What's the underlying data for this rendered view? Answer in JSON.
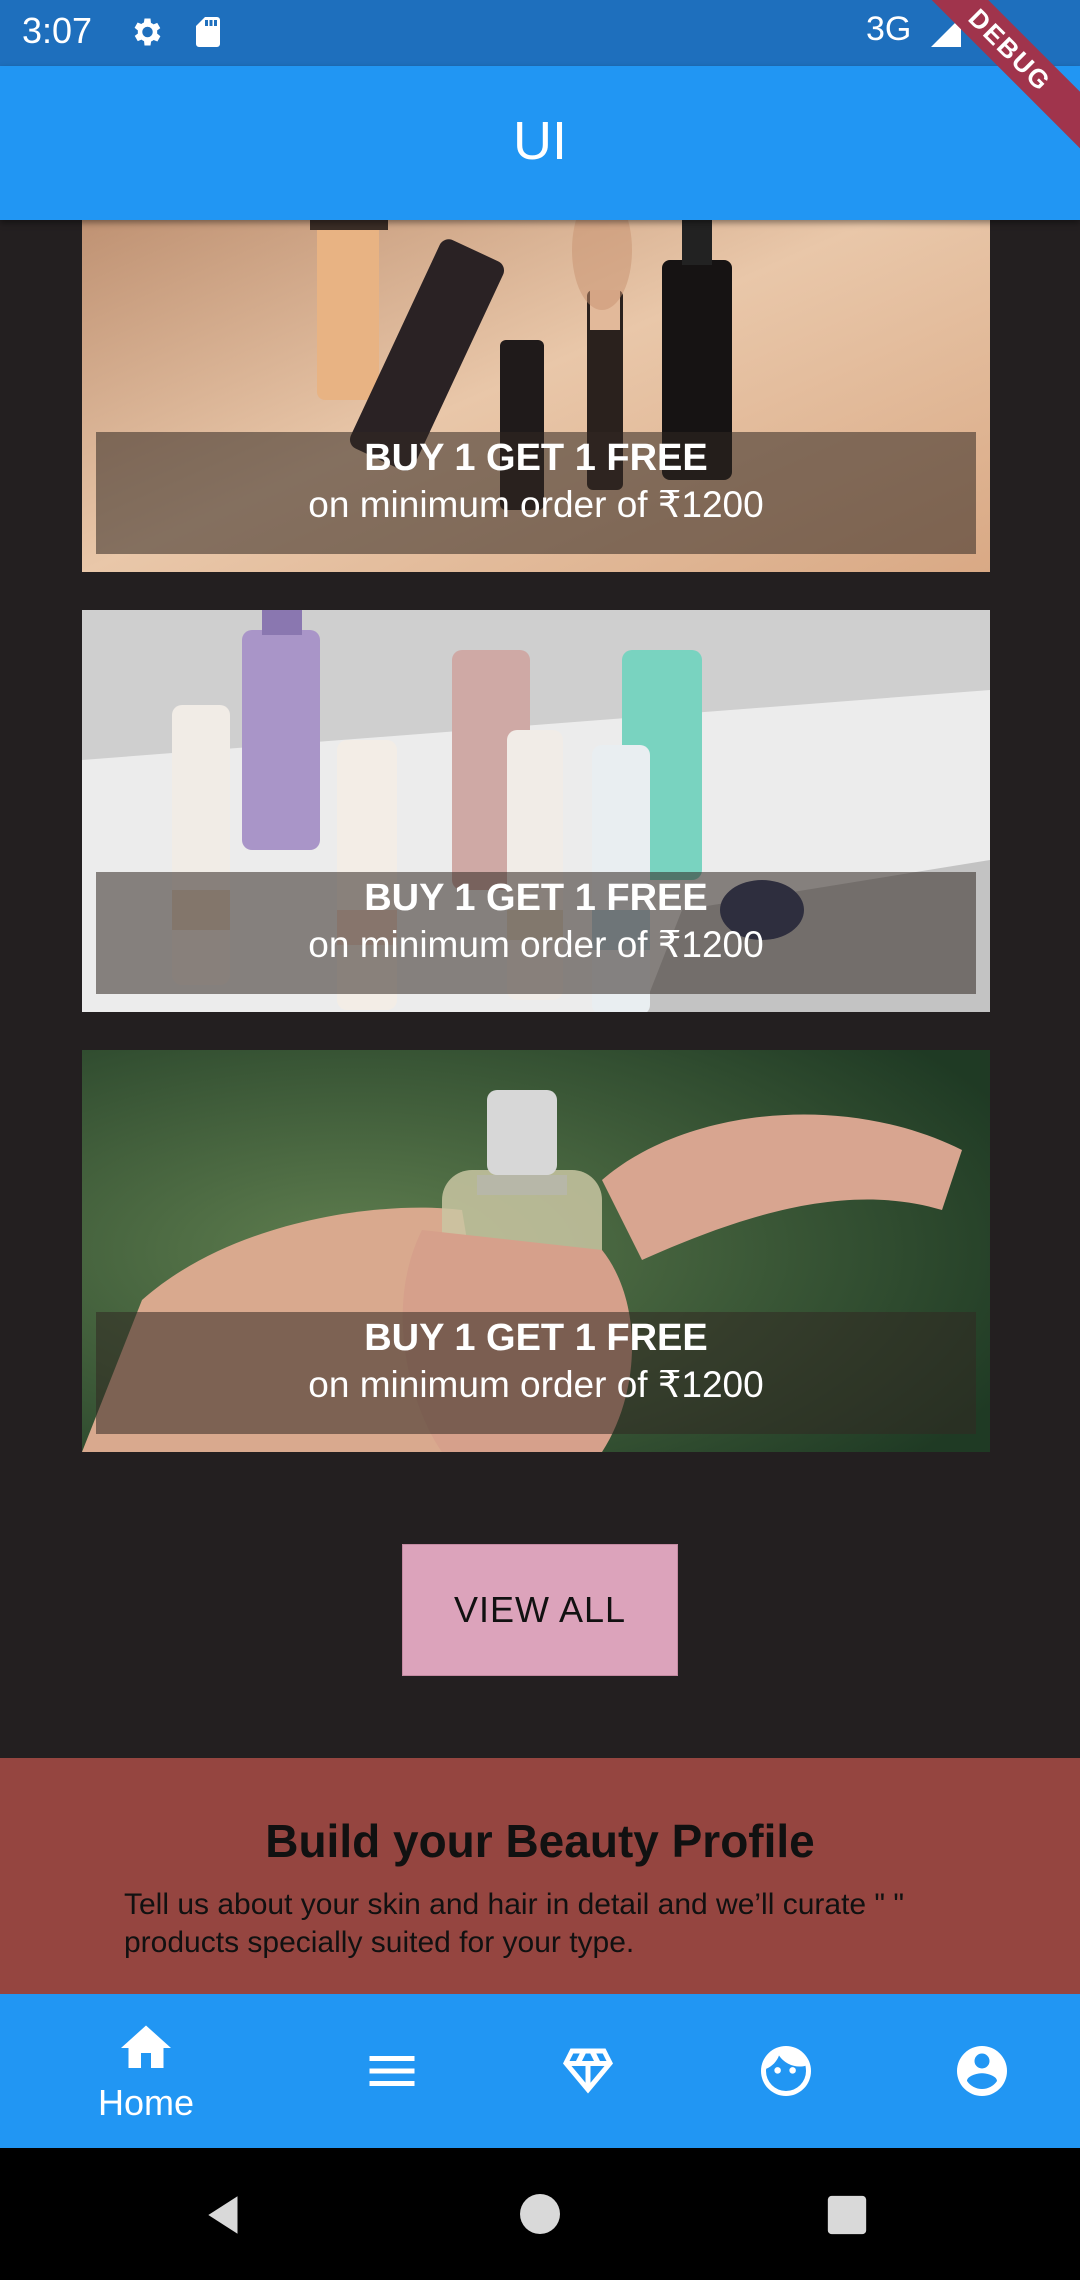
{
  "status": {
    "time": "3:07",
    "network": "3G",
    "debug_label": "DEBUG"
  },
  "app_bar": {
    "title": "UI"
  },
  "offers": [
    {
      "title": "BUY 1 GET 1 FREE",
      "subtitle": "on minimum order of ₹1200",
      "image": "makeup-foundation-bottles"
    },
    {
      "title": "BUY 1 GET 1 FREE",
      "subtitle": "on minimum order of ₹1200",
      "image": "haircare-tubes"
    },
    {
      "title": "BUY 1 GET 1 FREE",
      "subtitle": "on minimum order of ₹1200",
      "image": "perfume-bottle-hands"
    }
  ],
  "view_all": {
    "label": "VIEW ALL"
  },
  "beauty_profile": {
    "title": "Build your Beauty Profile",
    "description": "Tell us about your skin and hair in detail and we’ll curate \" \" products specially suited for your type."
  },
  "bottom_nav": {
    "items": [
      {
        "icon": "home-icon",
        "label": "Home"
      },
      {
        "icon": "menu-icon",
        "label": ""
      },
      {
        "icon": "diamond-icon",
        "label": ""
      },
      {
        "icon": "face-icon",
        "label": ""
      },
      {
        "icon": "account-icon",
        "label": ""
      }
    ]
  },
  "colors": {
    "app_bar": "#2196f3",
    "status_bar": "#1e6fbd",
    "background": "#231f20",
    "view_all_button": "#dca3bb",
    "beauty_section": "#954540"
  }
}
